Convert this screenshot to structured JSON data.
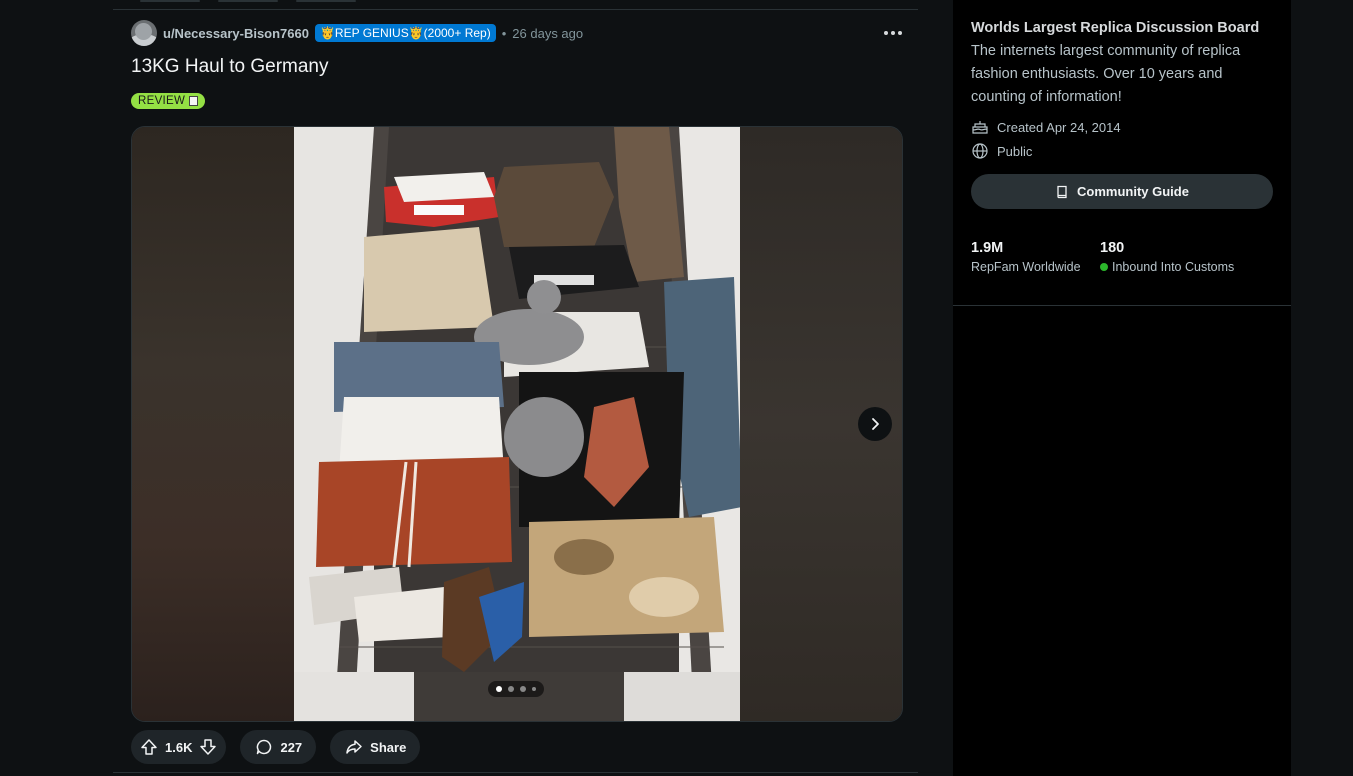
{
  "post": {
    "author": "u/Necessary-Bison7660",
    "flair": "🤴REP GENIUS🤴(2000+ Rep)",
    "separator": "•",
    "time": "26 days ago",
    "title": "13KG Haul to Germany",
    "tag": "REVIEW",
    "actions": {
      "votes": "1.6K",
      "comments": "227",
      "share_label": "Share"
    },
    "gallery": {
      "current_slide": 1,
      "total_slides": 4
    }
  },
  "sidebar": {
    "title": "Worlds Largest Replica Discussion Board",
    "description": "The internets largest community of replica fashion enthusiasts. Over 10 years and counting of information!",
    "created": "Created Apr 24, 2014",
    "visibility": "Public",
    "guide_label": "Community Guide",
    "stats": [
      {
        "value": "1.9M",
        "label": "RepFam Worldwide"
      },
      {
        "value": "180",
        "label": "Inbound Into Customs",
        "online": true
      }
    ]
  },
  "colors": {
    "background": "#0e1113",
    "sidebar": "#000000",
    "flair": "#0079d3",
    "tag": "#94e044",
    "online": "#2bb52b"
  }
}
